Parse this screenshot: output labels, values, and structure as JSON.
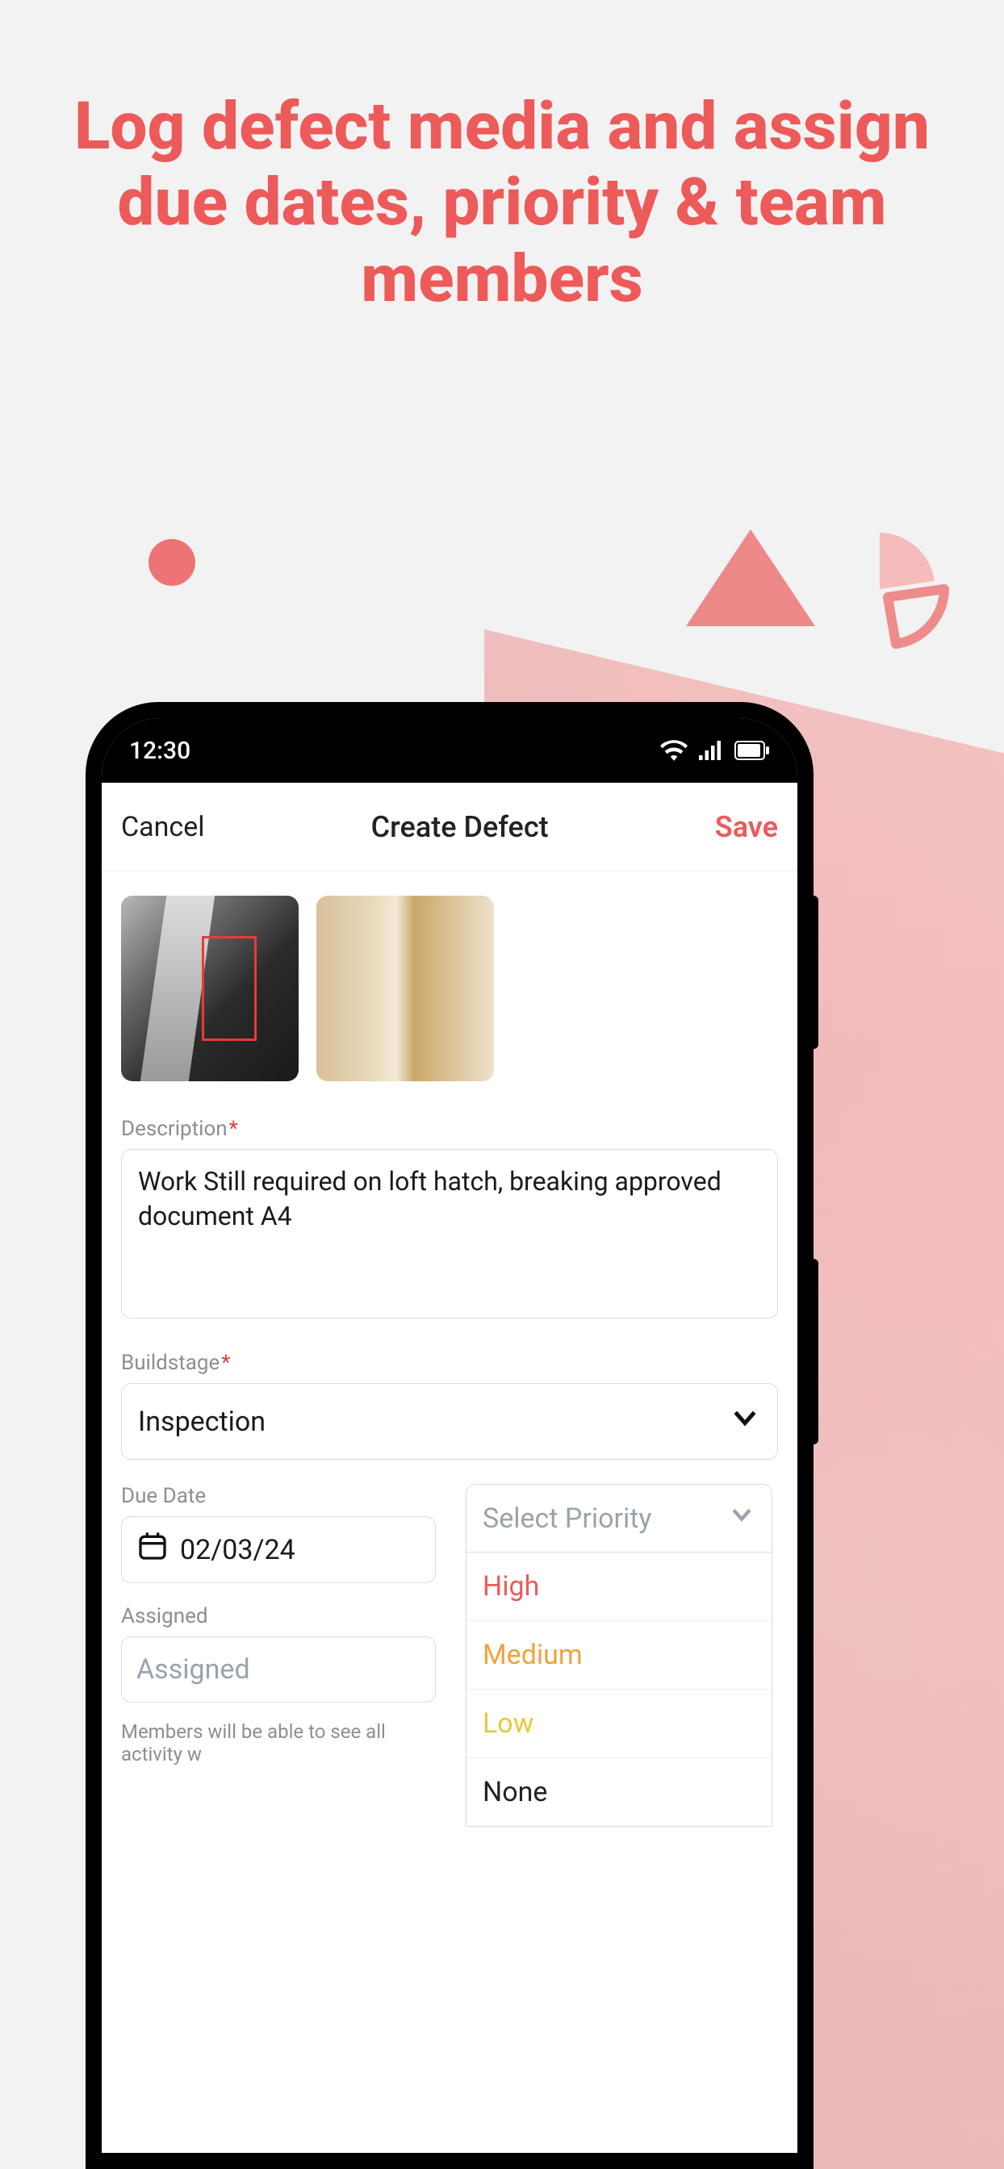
{
  "headline": "Log defect media and assign due dates, priority & team members",
  "statusbar": {
    "time": "12:30"
  },
  "header": {
    "cancel": "Cancel",
    "title": "Create Defect",
    "save": "Save"
  },
  "form": {
    "description_label": "Description",
    "description_value": "Work Still required on loft hatch, breaking approved document A4",
    "buildstage_label": "Buildstage",
    "buildstage_value": "Inspection",
    "due_date_label": "Due Date",
    "due_date_value": "02/03/24",
    "assigned_label": "Assigned",
    "assigned_placeholder": "Assigned",
    "members_hint": "Members will be able to see all activity w"
  },
  "priority": {
    "placeholder": "Select Priority",
    "options": {
      "high": "High",
      "medium": "Medium",
      "low": "Low",
      "none": "None"
    }
  }
}
